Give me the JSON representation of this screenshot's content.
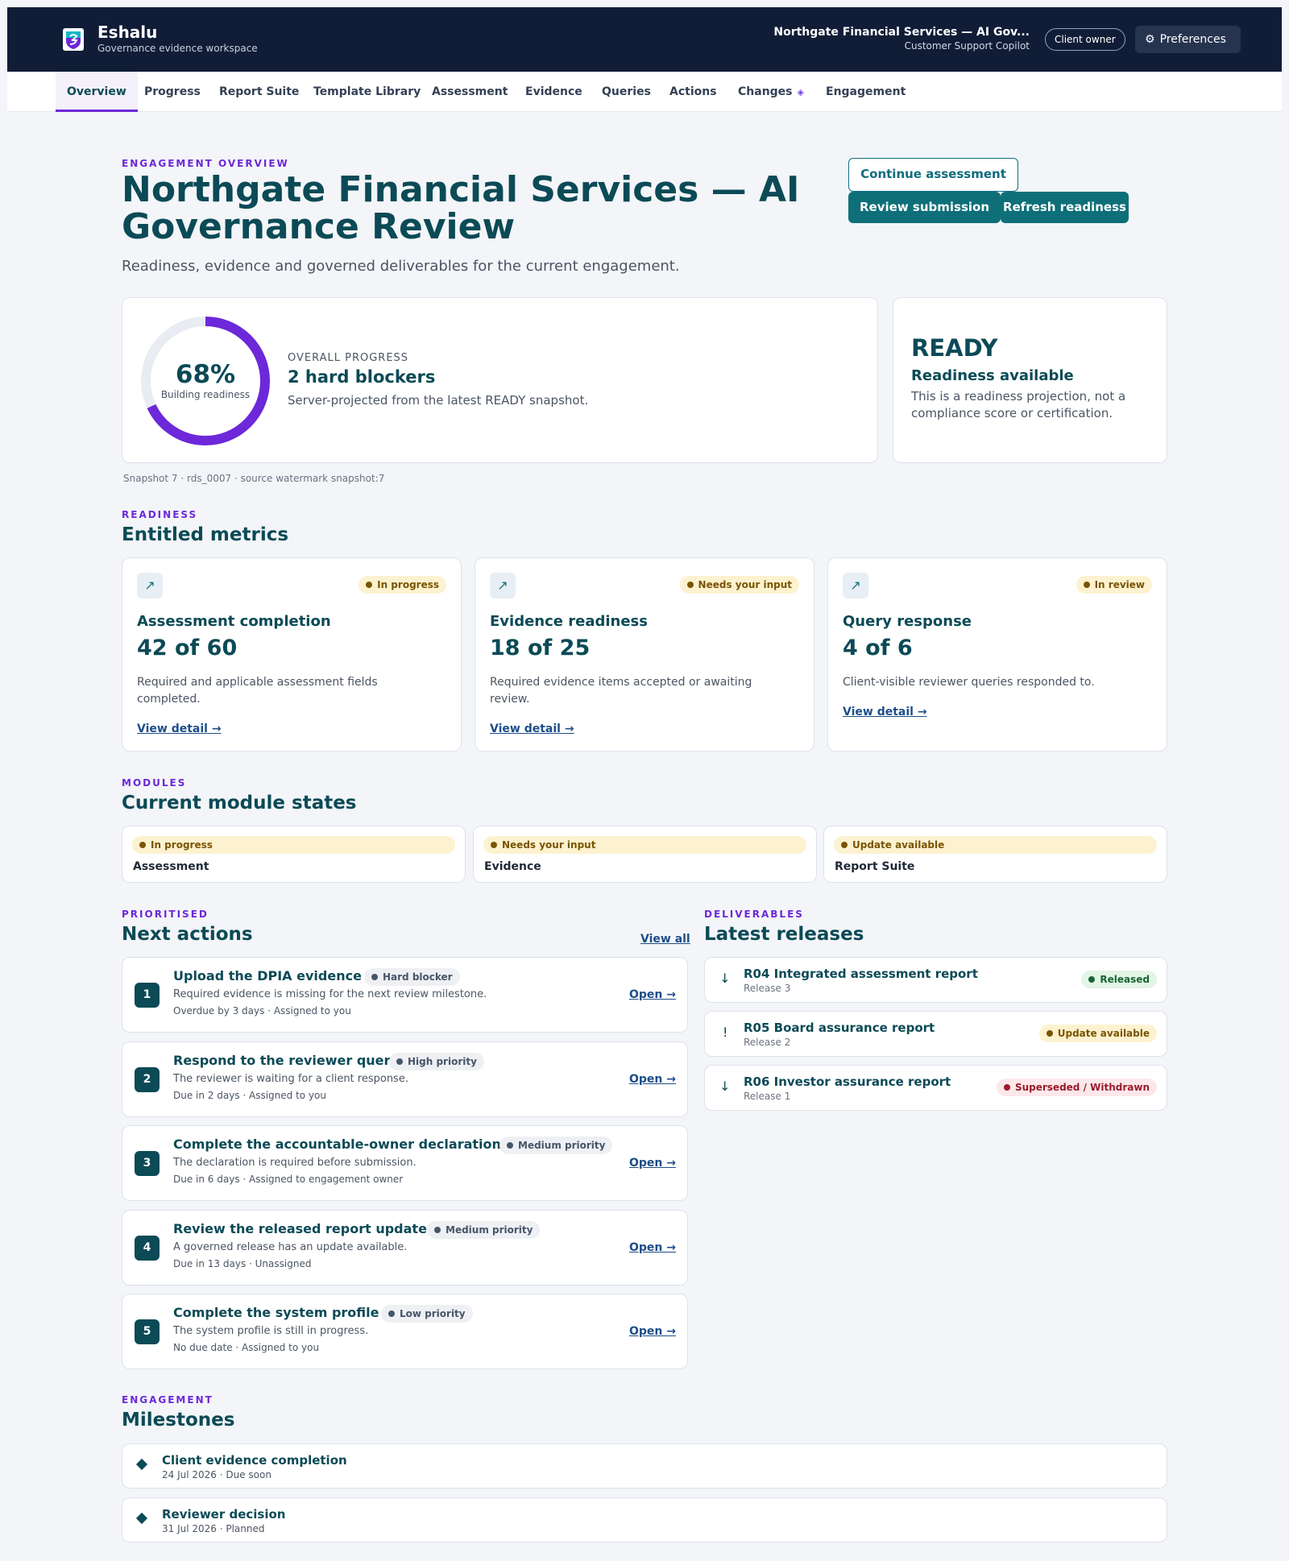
{
  "app": {
    "name": "Eshalu",
    "tagline": "Governance evidence workspace",
    "engagement_title": "Northgate Financial Services — AI Gov...",
    "engagement_subtitle": "Customer Support Copilot",
    "role": "Client owner",
    "preferences_label": "Preferences",
    "preferences_icon": "gear-icon"
  },
  "nav": {
    "items": [
      "Overview",
      "Progress",
      "Report Suite",
      "Template Library",
      "Assessment",
      "Evidence",
      "Queries",
      "Actions",
      "Changes",
      "Engagement"
    ],
    "active": "Overview",
    "changes_indicator": "◈"
  },
  "header": {
    "eyebrow": "ENGAGEMENT OVERVIEW",
    "title": "Northgate Financial Services — AI Governance Review",
    "subtitle": "Readiness, evidence and governed deliverables for the current engagement.",
    "buttons": {
      "continue": "Continue assessment",
      "review": "Review submission",
      "refresh": "Refresh readiness"
    }
  },
  "progress": {
    "percent_value": 68,
    "percent": "68%",
    "status": "Building readiness",
    "eyebrow": "OVERALL PROGRESS",
    "blockers": "2 hard blockers",
    "note": "Server-projected from the latest READY snapshot.",
    "snapshot": "Snapshot 7 · rds_0007 · source watermark snapshot:7",
    "ring_color": "#6d28d9",
    "track_color": "#e9ecf2"
  },
  "readiness": {
    "state": "READY",
    "title": "Readiness available",
    "description": "This is a readiness projection, not a compliance score or certification."
  },
  "metrics": {
    "eyebrow": "READINESS",
    "heading": "Entitled metrics",
    "items": [
      {
        "title": "Assessment completion",
        "value": "42 of 60",
        "badge": "In progress",
        "description": "Required and applicable assessment fields completed.",
        "link": "View detail →"
      },
      {
        "title": "Evidence readiness",
        "value": "18 of 25",
        "badge": "Needs your input",
        "description": "Required evidence items accepted or awaiting review.",
        "link": "View detail →"
      },
      {
        "title": "Query response",
        "value": "4 of 6",
        "badge": "In review",
        "description": "Client-visible reviewer queries responded to.",
        "link": "View detail →"
      }
    ],
    "icon": "↗"
  },
  "modules": {
    "eyebrow": "MODULES",
    "heading": "Current module states",
    "items": [
      {
        "name": "Assessment",
        "status": "In progress"
      },
      {
        "name": "Evidence",
        "status": "Needs your input"
      },
      {
        "name": "Report Suite",
        "status": "Update available"
      }
    ]
  },
  "actions": {
    "eyebrow": "PRIORITISED",
    "heading": "Next actions",
    "view_all": "View all",
    "open_label": "Open →",
    "items": [
      {
        "number": "1",
        "title": "Upload the DPIA evidence",
        "priority": "Hard blocker",
        "description": "Required evidence is missing for the next review milestone.",
        "meta": "Overdue by 3 days · Assigned to you"
      },
      {
        "number": "2",
        "title": "Respond to the reviewer query",
        "priority": "High priority",
        "description": "The reviewer is waiting for a client response.",
        "meta": "Due in 2 days · Assigned to you"
      },
      {
        "number": "3",
        "title": "Complete the accountable-owner declaration",
        "priority": "Medium priority",
        "description": "The declaration is required before submission.",
        "meta": "Due in 6 days · Assigned to engagement owner"
      },
      {
        "number": "4",
        "title": "Review the released report update",
        "priority": "Medium priority",
        "description": "A governed release has an update available.",
        "meta": "Due in 13 days · Unassigned"
      },
      {
        "number": "5",
        "title": "Complete the system profile",
        "priority": "Low priority",
        "description": "The system profile is still in progress.",
        "meta": "No due date · Assigned to you"
      }
    ]
  },
  "releases": {
    "eyebrow": "DELIVERABLES",
    "heading": "Latest releases",
    "items": [
      {
        "icon": "↓",
        "title": "R04 Integrated assessment report",
        "release": "Release 3",
        "status": "Released"
      },
      {
        "icon": "!",
        "title": "R05 Board assurance report",
        "release": "Release 2",
        "status": "Update available"
      },
      {
        "icon": "↓",
        "title": "R06 Investor assurance report",
        "release": "Release 1",
        "status": "Superseded / Withdrawn"
      }
    ]
  },
  "milestones": {
    "eyebrow": "ENGAGEMENT",
    "heading": "Milestones",
    "items": [
      {
        "title": "Client evidence completion",
        "meta": "24 Jul 2026 · Due soon"
      },
      {
        "title": "Reviewer decision",
        "meta": "31 Jul 2026 · Planned"
      }
    ]
  }
}
